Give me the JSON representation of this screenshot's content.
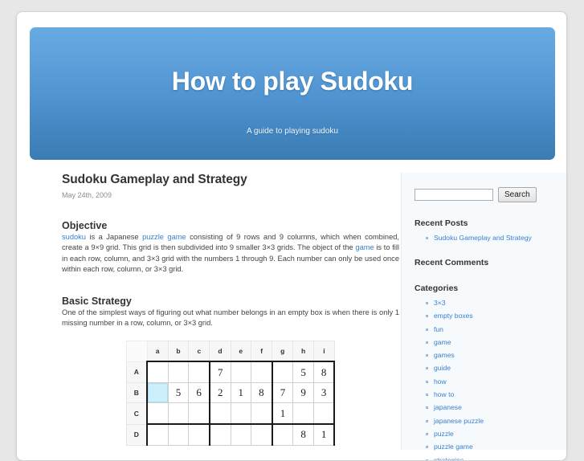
{
  "banner": {
    "title": "How to play Sudoku",
    "subtitle": "A guide to playing sudoku"
  },
  "post": {
    "title": "Sudoku Gameplay and Strategy",
    "date": "May 24th, 2009",
    "objective_heading": "Objective",
    "objective_text_1": "sudoku",
    "objective_text_2": " is a Japanese ",
    "objective_text_3": "puzzle game",
    "objective_text_4": " consisting of 9 rows and 9 columns, which when combined, create a 9×9 grid. This grid is then subdivided into 9 smaller 3×3 grids. The object of the ",
    "objective_text_5": "game",
    "objective_text_6": " is to fill in each row, column, and 3×3 grid with the numbers 1 through 9. Each number can only be used once within each row, column, or 3×3 grid.",
    "strategy_heading": "Basic Strategy",
    "strategy_text": "One of the simplest ways of figuring out what number belongs in an empty box is when there is only 1 missing number in a row, column, or 3×3 grid."
  },
  "grid": {
    "col_headers": [
      "a",
      "b",
      "c",
      "d",
      "e",
      "f",
      "g",
      "h",
      "i"
    ],
    "row_headers": [
      "A",
      "B",
      "C",
      "D"
    ],
    "rows": [
      [
        "",
        "",
        "",
        "7",
        "",
        "",
        "",
        "5",
        "8"
      ],
      [
        "",
        "5",
        "6",
        "2",
        "1",
        "8",
        "7",
        "9",
        "3"
      ],
      [
        "",
        "",
        "",
        "",
        "",
        "",
        "1",
        "",
        ""
      ],
      [
        "",
        "",
        "",
        "",
        "",
        "",
        "",
        "8",
        "1"
      ]
    ],
    "selected_cell": "B-a"
  },
  "sidebar": {
    "search_value": "",
    "search_placeholder": "",
    "search_button": "Search",
    "recent_posts_heading": "Recent Posts",
    "recent_posts": [
      "Sudoku Gameplay and Strategy"
    ],
    "recent_comments_heading": "Recent Comments",
    "recent_comments": [],
    "categories_heading": "Categories",
    "categories": [
      "3×3",
      "empty boxes",
      "fun",
      "game",
      "games",
      "guide",
      "how",
      "how to",
      "japanese",
      "japanese puzzle",
      "puzzle",
      "puzzle game",
      "strategies"
    ]
  },
  "colors": {
    "banner_top": "#67abe2",
    "banner_bottom": "#3c7cb2",
    "link": "#3a7fd0",
    "page_background": "#e7e7e7",
    "sidebar_background": "#f6fafc",
    "selected_cell": "#cdeefc"
  }
}
